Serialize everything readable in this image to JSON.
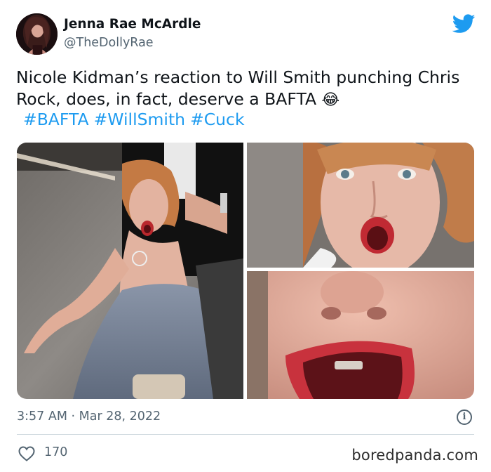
{
  "author": {
    "display_name": "Jenna Rae McArdle",
    "handle": "@TheDollyRae",
    "avatar_icon": "profile-photo"
  },
  "brand": {
    "icon": "twitter-bird-icon",
    "color": "#1d9bf0"
  },
  "tweet": {
    "text": "Nicole Kidman’s reaction to Will Smith punching Chris Rock, does, in fact, deserve a BAFTA",
    "emoji": "😂",
    "hashtags": [
      "#BAFTA",
      "#WillSmith",
      "#Cuck"
    ],
    "timestamp": "3:57 AM · Mar 28, 2022",
    "likes": "170"
  },
  "media": {
    "count": 3,
    "images": [
      "photo-full",
      "photo-zoom",
      "photo-close-up"
    ]
  },
  "watermark": "boredpanda.com",
  "colors": {
    "text": "#0f1419",
    "secondary": "#536471",
    "link": "#1d9bf0",
    "divider": "#cfd9de"
  }
}
